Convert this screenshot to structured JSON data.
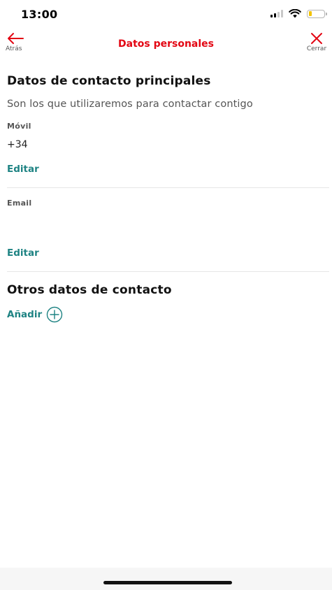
{
  "status_bar": {
    "time": "13:00",
    "battery_color": "#f2c200"
  },
  "header": {
    "back_label": "Atrás",
    "title": "Datos personales",
    "close_label": "Cerrar",
    "accent_color": "#e30613"
  },
  "main_contact": {
    "title": "Datos de contacto principales",
    "subtitle": "Son los que utilizaremos para contactar contigo",
    "mobile": {
      "label": "Móvil",
      "value": "+34 ",
      "edit_label": "Editar"
    },
    "email": {
      "label": "Email",
      "value": "",
      "edit_label": "Editar"
    }
  },
  "other_contact": {
    "title": "Otros datos de contacto",
    "add_label": "Añadir"
  },
  "icons": {
    "back": "arrow-left-icon",
    "close": "close-icon",
    "add": "plus-circle-icon"
  },
  "colors": {
    "link": "#1e8383"
  }
}
